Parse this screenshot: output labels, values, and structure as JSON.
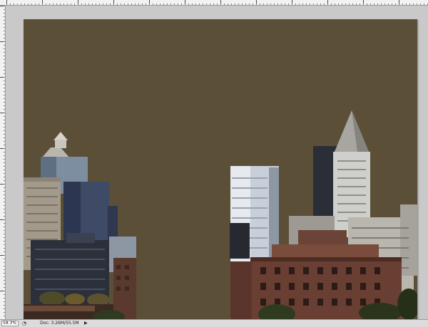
{
  "status_bar": {
    "zoom": "58.3%",
    "doc_info": "Doc: 3.26M/55.5M",
    "menu_arrow": "▶",
    "camera_icon": "◔"
  },
  "document": {
    "background_color": "#5b4f38"
  }
}
